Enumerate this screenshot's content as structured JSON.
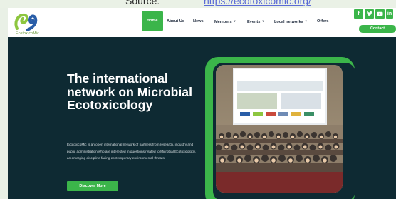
{
  "top_strip": {
    "fragments": [
      "Source:",
      "https://ecotoxicomic.org/"
    ]
  },
  "header": {
    "logo_alt": "ecotoxicomic-logo",
    "logo_text": "EcotoxicoMic",
    "nav": [
      {
        "label": "Home",
        "active": true,
        "dropdown": false
      },
      {
        "label": "About Us",
        "active": false,
        "dropdown": false
      },
      {
        "label": "News",
        "active": false,
        "dropdown": false
      },
      {
        "label": "Members",
        "active": false,
        "dropdown": true
      },
      {
        "label": "Events",
        "active": false,
        "dropdown": true
      },
      {
        "label": "Local networks",
        "active": false,
        "dropdown": true
      },
      {
        "label": "Offers",
        "active": false,
        "dropdown": false
      }
    ],
    "socials": [
      "facebook-icon",
      "twitter-icon",
      "youtube-icon",
      "linkedin-icon"
    ],
    "contact_label": "Contact"
  },
  "hero": {
    "title": "The international network on Microbial Ecotoxicology",
    "description": "EcotoxicoMic is an open international network of partners from research, industry and public administration who are interested in questions related to Microbial Ecotoxicology, an emerging discipline facing contemporary environmental threats.",
    "cta_label": "Discover More",
    "photo_banner_title": "Third International Conference on Microbial Ecotoxicology"
  },
  "colors": {
    "accent": "#3bb54a",
    "hero_bg": "#0e2a33",
    "nav_text": "#253042"
  }
}
